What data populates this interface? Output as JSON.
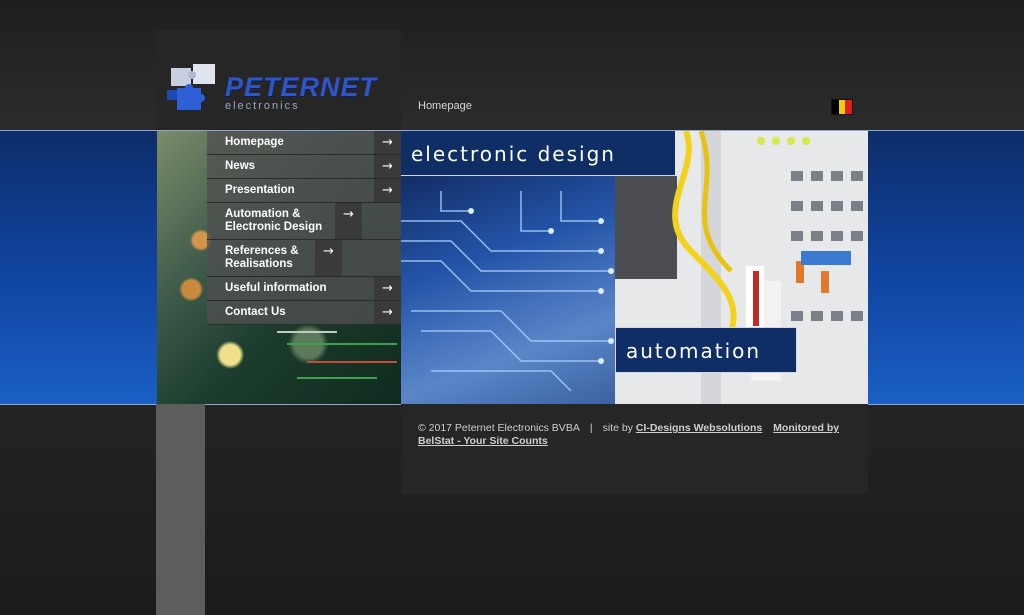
{
  "brand": {
    "logo_word": "PETERNET",
    "logo_sub": "electronics"
  },
  "breadcrumb": "Homepage",
  "flag": {
    "colors": [
      "#000000",
      "#f5d000",
      "#e02020"
    ]
  },
  "menu": {
    "items": [
      {
        "label": "Homepage"
      },
      {
        "label": "News"
      },
      {
        "label": "Presentation"
      },
      {
        "label": "Automation & Electronic Design"
      },
      {
        "label": "References & Realisations"
      },
      {
        "label": "Useful information"
      },
      {
        "label": "Contact Us"
      }
    ],
    "arrow_icon": "arrow-right-icon",
    "arrow_glyph": "→"
  },
  "banner": {
    "tag_top": "electronic design",
    "tag_bottom": "automation"
  },
  "footer": {
    "copyright": "© 2017 Peternet Electronics BVBA",
    "site_by_prefix": "site by ",
    "site_by_link": "CI-Designs Websolutions",
    "monitored_link": "Monitored by BelStat - Your Site Counts"
  },
  "colors": {
    "band_blue": "#1046a3",
    "menu_bg": "#505050",
    "page_bg": "#242424"
  }
}
